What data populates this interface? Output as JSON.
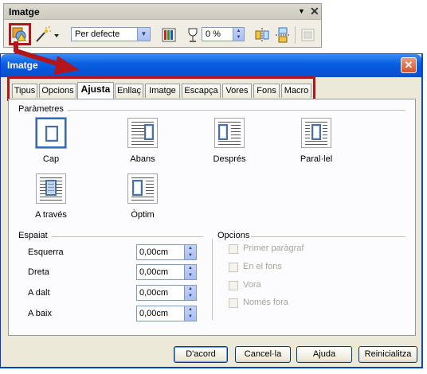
{
  "toolbar": {
    "title": "Imatge",
    "menu_arrow": "▼",
    "close_glyph": "✕",
    "mode_value": "Per defecte",
    "transparency_value": "0 %"
  },
  "dialog": {
    "title": "Imatge",
    "close_glyph": "✕",
    "tabs": [
      "Tipus",
      "Opcions",
      "Ajusta",
      "Enllaç",
      "Imatge",
      "Escapça",
      "Vores",
      "Fons",
      "Macro"
    ],
    "active_tab": "Ajusta",
    "wrap_group_label": "Paràmetres",
    "wrap_options": [
      {
        "label": "Cap",
        "selected": true
      },
      {
        "label": "Abans",
        "selected": false
      },
      {
        "label": "Després",
        "selected": false
      },
      {
        "label": "Paral·lel",
        "selected": false
      },
      {
        "label": "A través",
        "selected": false
      },
      {
        "label": "Òptim",
        "selected": false
      }
    ],
    "spacing_group_label": "Espaiat",
    "spacing": {
      "left_label": "Esquerra",
      "left_value": "0,00cm",
      "right_label": "Dreta",
      "right_value": "0,00cm",
      "top_label": "A dalt",
      "top_value": "0,00cm",
      "bottom_label": "A baix",
      "bottom_value": "0,00cm"
    },
    "options_group_label": "Opcions",
    "options": {
      "first_paragraph": "Primer paràgraf",
      "background": "En el fons",
      "contour": "Vora",
      "outside_only": "Només fora"
    },
    "buttons": {
      "ok": "D'acord",
      "cancel": "Cancel·la",
      "help": "Ajuda",
      "reset": "Reinicialitza"
    }
  },
  "colors": {
    "highlight_red": "#b3151d",
    "xp_blue": "#0054e3",
    "dialog_face": "#ece9d8"
  }
}
